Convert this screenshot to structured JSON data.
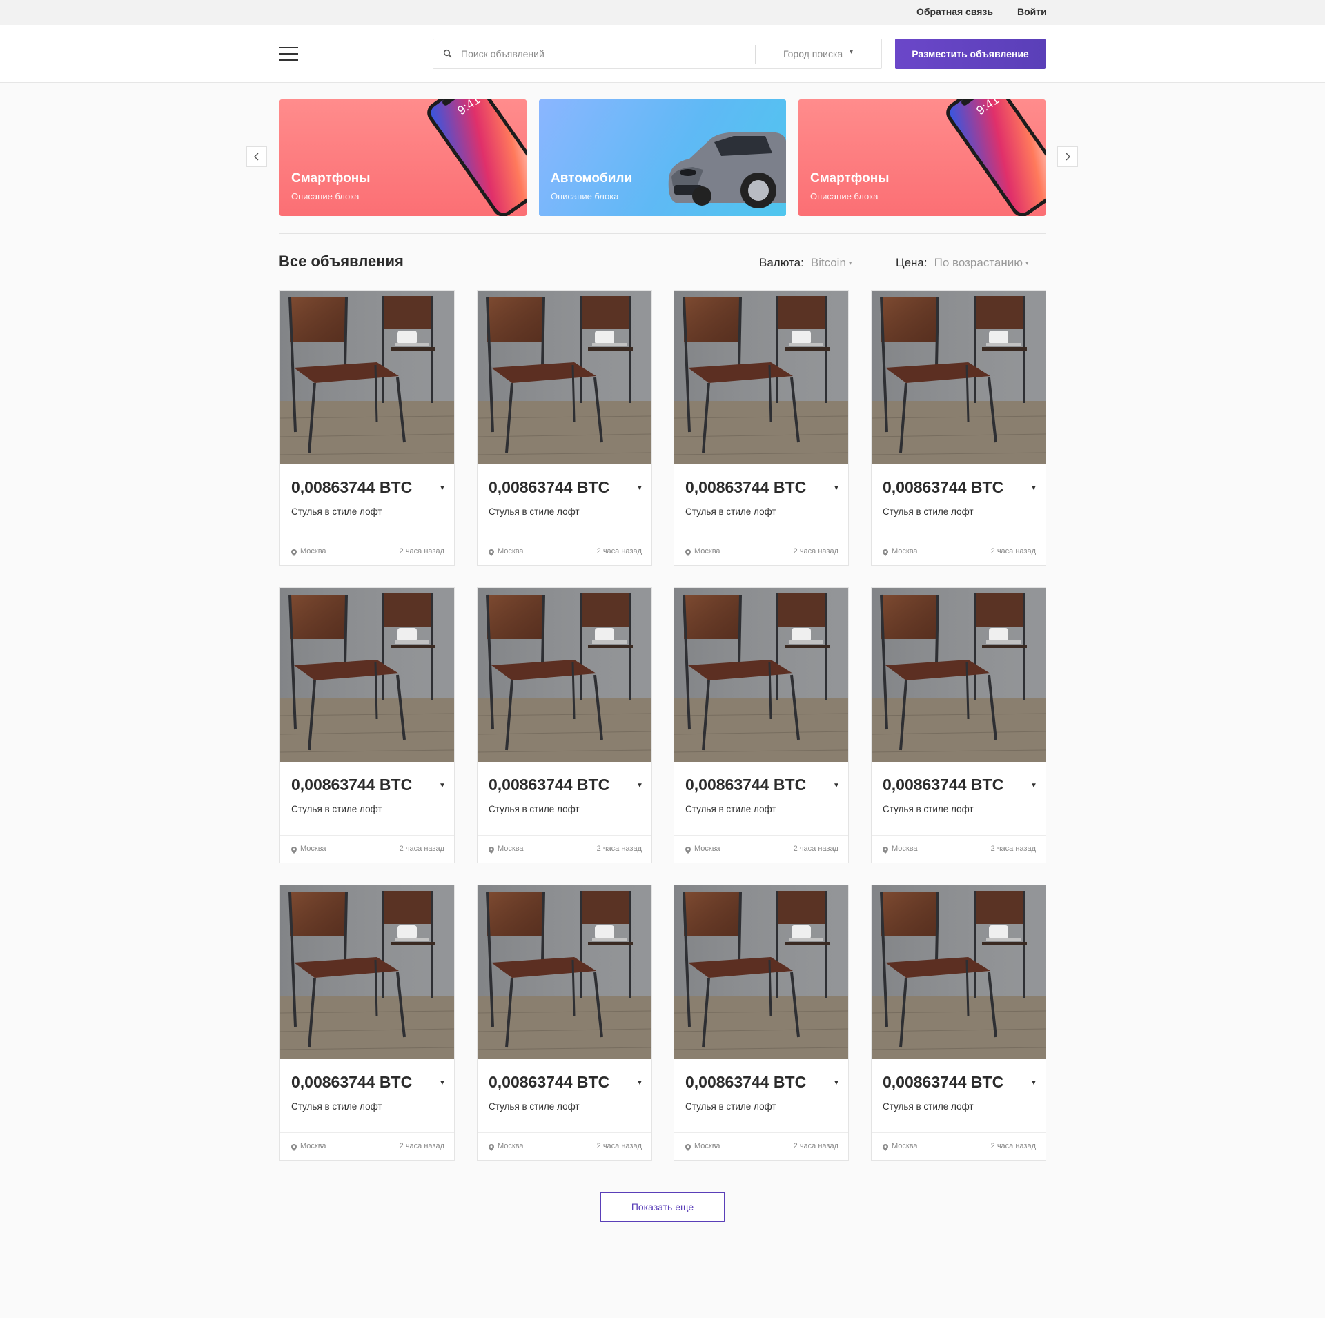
{
  "topbar": {
    "feedback": "Обратная связь",
    "login": "Войти"
  },
  "header": {
    "search_placeholder": "Поиск объявлений",
    "city_label": "Город поиска",
    "city_caret": "▾",
    "post_button": "Разместить объявление"
  },
  "banners": [
    {
      "title": "Смартфоны",
      "description": "Описание блока",
      "style": "pink"
    },
    {
      "title": "Автомобили",
      "description": "Описание блока",
      "style": "blue"
    },
    {
      "title": "Смартфоны",
      "description": "Описание блока",
      "style": "pink"
    }
  ],
  "listing": {
    "title": "Все объявления",
    "currency_label": "Валюта:",
    "currency_value": "Bitcoin",
    "price_label": "Цена:",
    "price_value": "По возрастанию",
    "caret": "▾",
    "show_more": "Показать еще"
  },
  "cards": [
    {
      "price": "0,00863744 BTC",
      "title": "Стулья в стиле лофт",
      "location": "Москва",
      "time": "2 часа назад"
    },
    {
      "price": "0,00863744 BTC",
      "title": "Стулья в стиле лофт",
      "location": "Москва",
      "time": "2 часа назад"
    },
    {
      "price": "0,00863744 BTC",
      "title": "Стулья в стиле лофт",
      "location": "Москва",
      "time": "2 часа назад"
    },
    {
      "price": "0,00863744 BTC",
      "title": "Стулья в стиле лофт",
      "location": "Москва",
      "time": "2 часа назад"
    },
    {
      "price": "0,00863744 BTC",
      "title": "Стулья в стиле лофт",
      "location": "Москва",
      "time": "2 часа назад"
    },
    {
      "price": "0,00863744 BTC",
      "title": "Стулья в стиле лофт",
      "location": "Москва",
      "time": "2 часа назад"
    },
    {
      "price": "0,00863744 BTC",
      "title": "Стулья в стиле лофт",
      "location": "Москва",
      "time": "2 часа назад"
    },
    {
      "price": "0,00863744 BTC",
      "title": "Стулья в стиле лофт",
      "location": "Москва",
      "time": "2 часа назад"
    },
    {
      "price": "0,00863744 BTC",
      "title": "Стулья в стиле лофт",
      "location": "Москва",
      "time": "2 часа назад"
    },
    {
      "price": "0,00863744 BTC",
      "title": "Стулья в стиле лофт",
      "location": "Москва",
      "time": "2 часа назад"
    },
    {
      "price": "0,00863744 BTC",
      "title": "Стулья в стиле лофт",
      "location": "Москва",
      "time": "2 часа назад"
    },
    {
      "price": "0,00863744 BTC",
      "title": "Стулья в стиле лофт",
      "location": "Москва",
      "time": "2 часа назад"
    }
  ],
  "icons": {
    "menu": "hamburger-menu-icon",
    "search": "search-icon",
    "prev": "chevron-left-icon",
    "next": "chevron-right-icon",
    "location": "map-pin-icon",
    "caret": "caret-down-icon"
  },
  "colors": {
    "accent": "#5a3fb8",
    "banner_pink": "#fb6f74",
    "banner_blue": "#5fb9f5"
  }
}
